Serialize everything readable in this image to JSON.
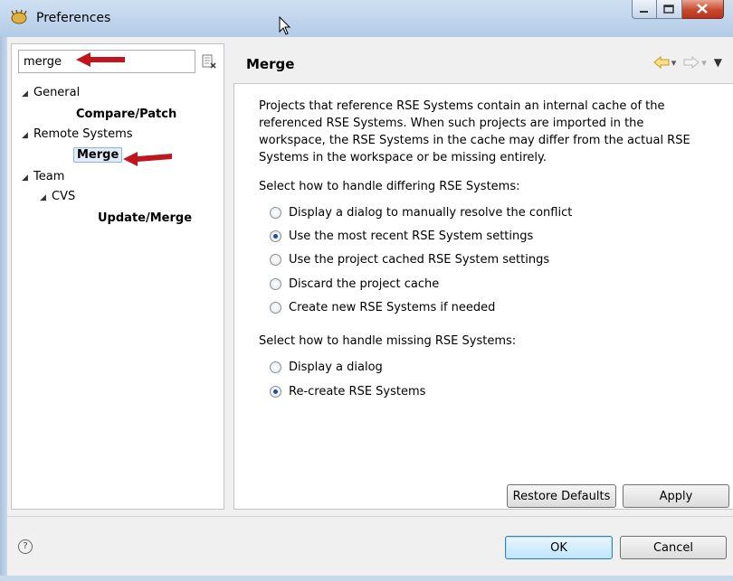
{
  "window": {
    "title": "Preferences"
  },
  "filter": {
    "value": "merge"
  },
  "tree": {
    "general": "General",
    "compare_patch": "Compare/Patch",
    "remote_systems": "Remote Systems",
    "merge": "Merge",
    "team": "Team",
    "cvs": "CVS",
    "update_merge": "Update/Merge"
  },
  "page": {
    "title": "Merge",
    "description": "Projects that reference RSE Systems contain an internal cache of the referenced RSE Systems. When such projects are imported in the workspace, the RSE Systems in the cache may differ from the actual RSE Systems in the workspace or be missing entirely.",
    "differing_label": "Select how to handle differing RSE Systems:",
    "differing_options": [
      "Display a dialog to manually resolve the conflict",
      "Use the most recent RSE System settings",
      "Use the project cached RSE System settings",
      "Discard the project cache",
      "Create new RSE Systems if needed"
    ],
    "differing_selected": 1,
    "missing_label": "Select how to handle missing RSE Systems:",
    "missing_options": [
      "Display a dialog",
      "Re-create RSE Systems"
    ],
    "missing_selected": 1,
    "restore_defaults": "Restore Defaults",
    "apply": "Apply"
  },
  "footer": {
    "help": "?",
    "ok": "OK",
    "cancel": "Cancel"
  },
  "colors": {
    "annotation_arrow": "#c0171f",
    "selection_bg": "#e0ecfa"
  }
}
